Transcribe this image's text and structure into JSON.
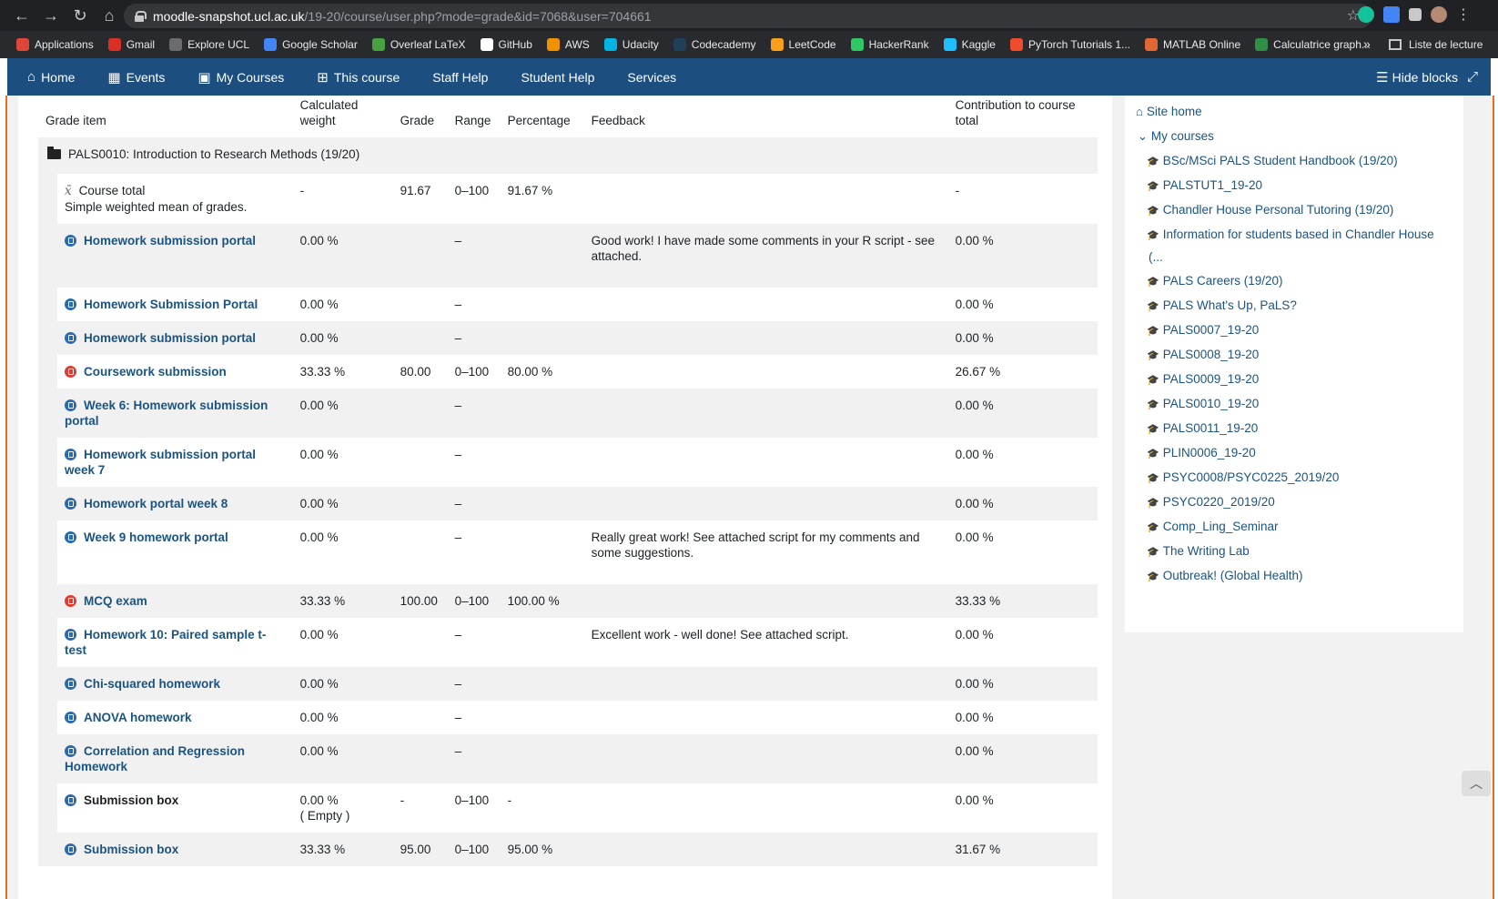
{
  "browser": {
    "url_host": "moodle-snapshot.ucl.ac.uk",
    "url_path": "/19-20/course/user.php?mode=grade&id=7068&user=704661",
    "bookmarks": [
      {
        "label": "Applications",
        "color": "#e0453a"
      },
      {
        "label": "Gmail",
        "color": "#d93025"
      },
      {
        "label": "Explore UCL",
        "color": "#6c6c6c"
      },
      {
        "label": "Google Scholar",
        "color": "#4285f4"
      },
      {
        "label": "Overleaf LaTeX",
        "color": "#47a141"
      },
      {
        "label": "GitHub",
        "color": "#ffffff"
      },
      {
        "label": "AWS",
        "color": "#f29100"
      },
      {
        "label": "Udacity",
        "color": "#02b3e4"
      },
      {
        "label": "Codecademy",
        "color": "#1f4056"
      },
      {
        "label": "LeetCode",
        "color": "#f89f1b"
      },
      {
        "label": "HackerRank",
        "color": "#2ec866"
      },
      {
        "label": "Kaggle",
        "color": "#20beff"
      },
      {
        "label": "PyTorch Tutorials 1...",
        "color": "#ee4c2c"
      },
      {
        "label": "MATLAB Online",
        "color": "#e16737"
      },
      {
        "label": "Calculatrice graph...",
        "color": "#2f8f46"
      }
    ],
    "more": "»",
    "reading_list": "Liste de lecture"
  },
  "nav": {
    "home": "Home",
    "events": "Events",
    "my_courses": "My Courses",
    "this_course": "This course",
    "staff_help": "Staff Help",
    "student_help": "Student Help",
    "services": "Services",
    "hide_blocks": "Hide blocks"
  },
  "table": {
    "headers": {
      "item": "Grade item",
      "weight": "Calculated weight",
      "grade": "Grade",
      "range": "Range",
      "percentage": "Percentage",
      "feedback": "Feedback",
      "contribution": "Contribution to course total"
    },
    "category": "PALS0010: Introduction to Research Methods (19/20)",
    "course_total": {
      "label": "Course total",
      "sub": "Simple weighted mean of grades.",
      "weight": "-",
      "grade": "91.67",
      "range": "0–100",
      "percentage": "91.67 %",
      "contribution": "-"
    },
    "rows": [
      {
        "name": "Homework submission portal",
        "icon": "blue",
        "link": true,
        "weight": "0.00 %",
        "grade": "",
        "range": "–",
        "percentage": "",
        "feedback": "Good work! I have made some comments in your R script - see attached.",
        "contribution": "0.00 %"
      },
      {
        "name": "Homework Submission Portal",
        "icon": "blue",
        "link": true,
        "weight": "0.00 %",
        "grade": "",
        "range": "–",
        "percentage": "",
        "feedback": "",
        "contribution": "0.00 %"
      },
      {
        "name": "Homework submission portal",
        "icon": "blue",
        "link": true,
        "weight": "0.00 %",
        "grade": "",
        "range": "–",
        "percentage": "",
        "feedback": "",
        "contribution": "0.00 %"
      },
      {
        "name": "Coursework submission",
        "icon": "red",
        "link": true,
        "weight": "33.33 %",
        "grade": "80.00",
        "range": "0–100",
        "percentage": "80.00 %",
        "feedback": "",
        "contribution": "26.67 %"
      },
      {
        "name": "Week 6: Homework submission portal",
        "icon": "blue",
        "link": true,
        "weight": "0.00 %",
        "grade": "",
        "range": "–",
        "percentage": "",
        "feedback": "",
        "contribution": "0.00 %"
      },
      {
        "name": "Homework submission portal week 7",
        "icon": "blue",
        "link": true,
        "weight": "0.00 %",
        "grade": "",
        "range": "–",
        "percentage": "",
        "feedback": "",
        "contribution": "0.00 %"
      },
      {
        "name": "Homework portal week 8",
        "icon": "blue",
        "link": true,
        "weight": "0.00 %",
        "grade": "",
        "range": "–",
        "percentage": "",
        "feedback": "",
        "contribution": "0.00 %"
      },
      {
        "name": "Week 9 homework portal",
        "icon": "blue",
        "link": true,
        "weight": "0.00 %",
        "grade": "",
        "range": "–",
        "percentage": "",
        "feedback": "Really great work! See attached script for my comments and some suggestions.",
        "contribution": "0.00 %"
      },
      {
        "name": "MCQ exam",
        "icon": "red",
        "link": true,
        "weight": "33.33 %",
        "grade": "100.00",
        "range": "0–100",
        "percentage": "100.00 %",
        "feedback": "",
        "contribution": "33.33 %"
      },
      {
        "name": "Homework 10: Paired sample t-test",
        "icon": "blue",
        "link": true,
        "weight": "0.00 %",
        "grade": "",
        "range": "–",
        "percentage": "",
        "feedback": "Excellent work - well done! See attached script.",
        "contribution": "0.00 %"
      },
      {
        "name": "Chi-squared homework",
        "icon": "blue",
        "link": true,
        "weight": "0.00 %",
        "grade": "",
        "range": "–",
        "percentage": "",
        "feedback": "",
        "contribution": "0.00 %"
      },
      {
        "name": "ANOVA homework",
        "icon": "blue",
        "link": true,
        "weight": "0.00 %",
        "grade": "",
        "range": "–",
        "percentage": "",
        "feedback": "",
        "contribution": "0.00 %"
      },
      {
        "name": "Correlation and Regression Homework",
        "icon": "blue",
        "link": true,
        "weight": "0.00 %",
        "grade": "",
        "range": "–",
        "percentage": "",
        "feedback": "",
        "contribution": "0.00 %"
      },
      {
        "name": "Submission box",
        "icon": "blue",
        "link": false,
        "weight": "0.00 %",
        "weight2": "( Empty )",
        "grade": "-",
        "range": "0–100",
        "percentage": "-",
        "feedback": "",
        "contribution": "0.00 %"
      },
      {
        "name": "Submission box",
        "icon": "blue",
        "link": true,
        "weight": "33.33 %",
        "grade": "95.00",
        "range": "0–100",
        "percentage": "95.00 %",
        "feedback": "",
        "contribution": "31.67 %"
      }
    ]
  },
  "block": {
    "site_home": "Site home",
    "my_courses": "My courses",
    "courses": [
      "BSc/MSci PALS Student Handbook (19/20)",
      "PALSTUT1_19-20",
      "Chandler House Personal Tutoring (19/20)",
      "Information for students based in Chandler House",
      "(...",
      "PALS Careers (19/20)",
      "PALS What's Up, PaLS?",
      "PALS0007_19-20",
      "PALS0008_19-20",
      "PALS0009_19-20",
      "PALS0010_19-20",
      "PALS0011_19-20",
      "PLIN0006_19-20",
      "PSYC0008/PSYC0225_2019/20",
      "PSYC0220_2019/20",
      "Comp_Ling_Seminar",
      "The Writing Lab",
      "Outbreak! (Global Health)"
    ]
  },
  "colors": {
    "nav": "#1c4e80",
    "link": "#1b5482",
    "accent_border": "#e86d1f"
  }
}
